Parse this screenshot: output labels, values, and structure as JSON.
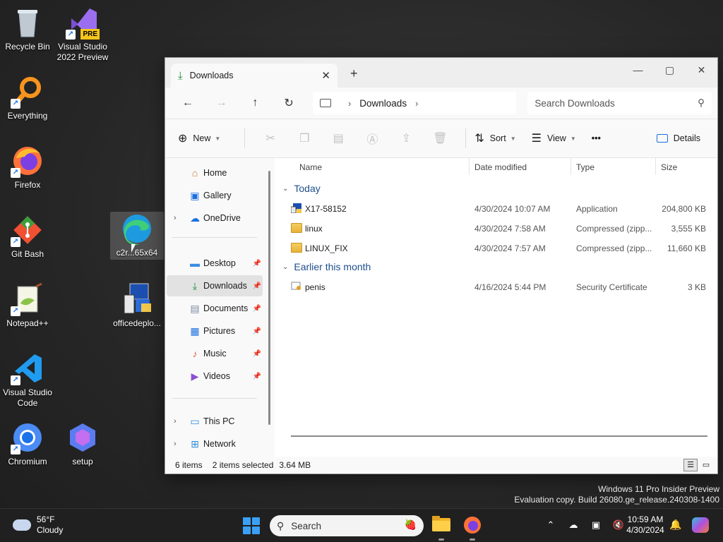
{
  "desktop": {
    "icons": [
      {
        "label": "Recycle Bin"
      },
      {
        "label": "Visual Studio 2022 Preview",
        "badge": "PRE"
      },
      {
        "label": "Everything"
      },
      {
        "label": "Firefox"
      },
      {
        "label": "Git Bash"
      },
      {
        "label": "Notepad++"
      },
      {
        "label": "Visual Studio Code"
      },
      {
        "label": "Chromium"
      },
      {
        "label": "setup"
      },
      {
        "label": "c2r...65x64"
      },
      {
        "label": "officedeplo..."
      }
    ]
  },
  "window": {
    "tab_title": "Downloads",
    "address": {
      "location": "Downloads"
    },
    "search_placeholder": "Search Downloads",
    "commands": {
      "new": "New",
      "sort": "Sort",
      "view": "View",
      "more": "•••",
      "details": "Details"
    },
    "nav": {
      "items": [
        {
          "label": "Home"
        },
        {
          "label": "Gallery"
        },
        {
          "label": "OneDrive"
        },
        {
          "label": "Desktop"
        },
        {
          "label": "Downloads"
        },
        {
          "label": "Documents"
        },
        {
          "label": "Pictures"
        },
        {
          "label": "Music"
        },
        {
          "label": "Videos"
        },
        {
          "label": "This PC"
        },
        {
          "label": "Network"
        }
      ]
    },
    "columns": {
      "name": "Name",
      "date": "Date modified",
      "type": "Type",
      "size": "Size"
    },
    "groups": [
      {
        "label": "Today",
        "files": [
          {
            "name": "X17-58152",
            "date": "4/30/2024 10:07 AM",
            "type": "Application",
            "size": "204,800 KB"
          },
          {
            "name": "linux",
            "date": "4/30/2024 7:58 AM",
            "type": "Compressed (zipp...",
            "size": "3,555 KB"
          },
          {
            "name": "LINUX_FIX",
            "date": "4/30/2024 7:57 AM",
            "type": "Compressed (zipp...",
            "size": "11,660 KB"
          }
        ]
      },
      {
        "label": "Earlier this month",
        "files": [
          {
            "name": "penis",
            "date": "4/16/2024 5:44 PM",
            "type": "Security Certificate",
            "size": "3 KB"
          }
        ]
      }
    ],
    "status": {
      "count": "6 items",
      "selected": "2 items selected",
      "size": "3.64 MB"
    }
  },
  "watermark": {
    "line1": "Windows 11 Pro Insider Preview",
    "line2": "Evaluation copy. Build 26080.ge_release.240308-1400"
  },
  "taskbar": {
    "weather": {
      "temp": "56°F",
      "condition": "Cloudy"
    },
    "search_placeholder": "Search",
    "time": "10:59 AM",
    "date": "4/30/2024"
  }
}
